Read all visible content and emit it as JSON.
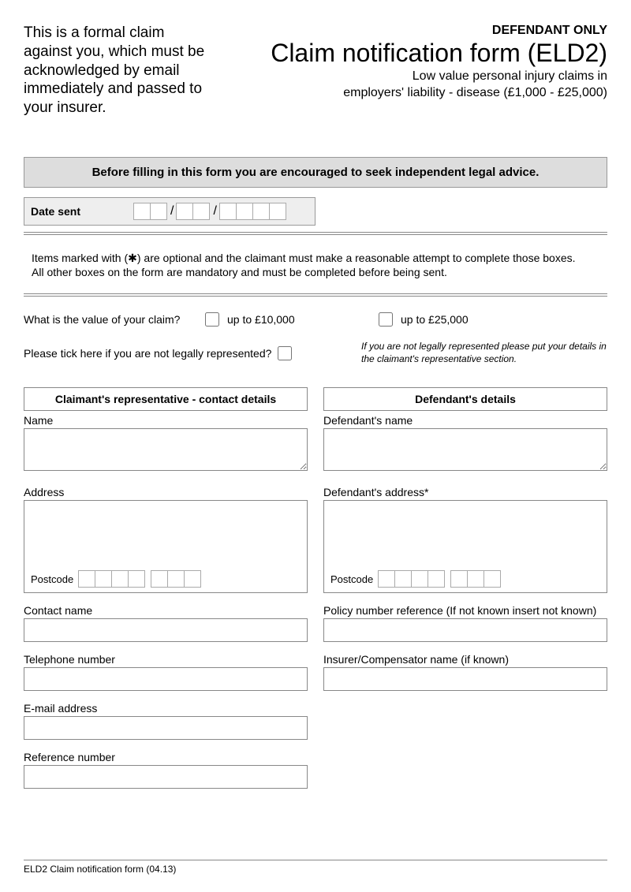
{
  "header": {
    "notice": "This is a formal claim against you, which must be acknowledged by email immediately and passed to your insurer.",
    "defendant_only": "DEFENDANT ONLY",
    "title": "Claim notification form (ELD2)",
    "subtitle1": "Low value personal injury claims in",
    "subtitle2": "employers' liability - disease (£1,000 - £25,000)"
  },
  "advice": "Before filling in this form you are encouraged to seek independent legal advice.",
  "date_sent_label": "Date sent",
  "items_note_line1": "Items marked with (✱) are optional and the claimant must make a reasonable attempt to complete those boxes.",
  "items_note_line2": "All other boxes on the form are mandatory and must be completed before being sent.",
  "value_question": "What is the value of your claim?",
  "value_opt1": "up to £10,000",
  "value_opt2": "up to £25,000",
  "represent_question": "Please tick here if you are not legally represented?",
  "represent_note": "If you are not legally represented please put your details in the claimant's representative section.",
  "claimant_section": {
    "header": "Claimant's representative - contact details",
    "name_label": "Name",
    "address_label": "Address",
    "postcode_label": "Postcode",
    "contact_name_label": "Contact name",
    "telephone_label": "Telephone number",
    "email_label": "E-mail address",
    "reference_label": "Reference number"
  },
  "defendant_section": {
    "header": "Defendant's details",
    "name_label": "Defendant's name",
    "address_label": "Defendant's address*",
    "postcode_label": "Postcode",
    "policy_label": "Policy number reference (If not known insert not known)",
    "insurer_label": "Insurer/Compensator name (if known)"
  },
  "footer": "ELD2 Claim notification form (04.13)"
}
